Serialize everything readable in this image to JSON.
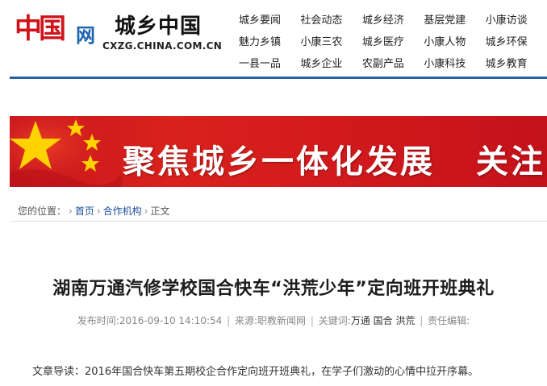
{
  "header": {
    "logo_red_text": "中国",
    "logo_blue_text": "网",
    "site_name": "城乡中国",
    "site_url": "CXZG.CHINA.COM.CN"
  },
  "nav": {
    "rows": [
      [
        "城乡要闻",
        "社会动态",
        "城乡经济",
        "基层党建",
        "小康访谈"
      ],
      [
        "魅力乡镇",
        "小康三农",
        "城乡医疗",
        "小康人物",
        "城乡环保"
      ],
      [
        "一县一品",
        "城乡企业",
        "农副产品",
        "小康科技",
        "城乡教育"
      ]
    ]
  },
  "banner": {
    "text": "聚焦城乡一体化发展",
    "text_2": "关注",
    "colors": {
      "background": "#d21a1c",
      "star": "#ffd200"
    }
  },
  "breadcrumb": {
    "label": "您的位置：",
    "items": [
      "首页",
      "合作机构",
      "正文"
    ],
    "separator": "›"
  },
  "article": {
    "title": "湖南万通汽修学校国合快车“洪荒少年”定向班开班典礼",
    "meta": {
      "time_label": "发布时间:",
      "time": "2016-09-10 14:10:54",
      "source_label": "来源:",
      "source": "职教新闻网",
      "keywords_label": "关键词:",
      "keywords": "万通 国合 洪荒",
      "editor_label": "责任编辑:",
      "separator": "|"
    },
    "lead_label": "文章导读：",
    "lead_text": "2016年国合快车第五期校企合作定向班开班典礼，在学子们激动的心情中拉开序幕。"
  },
  "colors": {
    "brand_red": "#d0121a",
    "brand_blue": "#1d63b0",
    "rule_blue": "#2a5da8",
    "link_blue": "#1a4c9c"
  }
}
